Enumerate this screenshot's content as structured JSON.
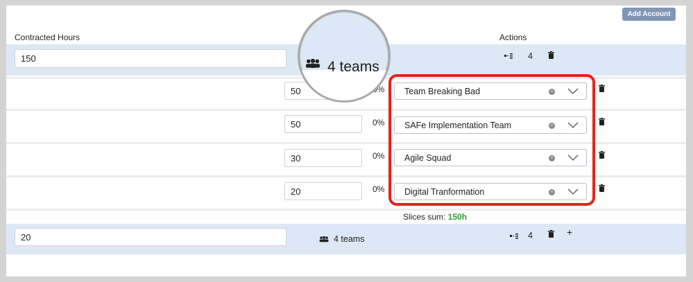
{
  "toolbar": {
    "add_account_label": "Add Account"
  },
  "headers": {
    "contracted_hours": "Contracted Hours",
    "actions": "Actions"
  },
  "account1": {
    "hours": "150",
    "teams_label": "4 teams",
    "action_count": "4",
    "slices": [
      {
        "value": "50",
        "percent": "0%",
        "team": "Team Breaking Bad"
      },
      {
        "value": "50",
        "percent": "0%",
        "team": "SAFe Implementation Team"
      },
      {
        "value": "30",
        "percent": "0%",
        "team": "Agile Squad"
      },
      {
        "value": "20",
        "percent": "0%",
        "team": "Digital Tranformation"
      }
    ],
    "slices_sum_label": "Slices sum:",
    "slices_sum_value": "150h"
  },
  "account2": {
    "hours": "20",
    "teams_label": "4 teams",
    "action_count": "4",
    "add_symbol": "+"
  },
  "colors": {
    "row_highlight": "#dce8f5",
    "add_button": "#8096b5",
    "annotation_red": "#e8231b",
    "sum_green": "#2e9c2e"
  }
}
